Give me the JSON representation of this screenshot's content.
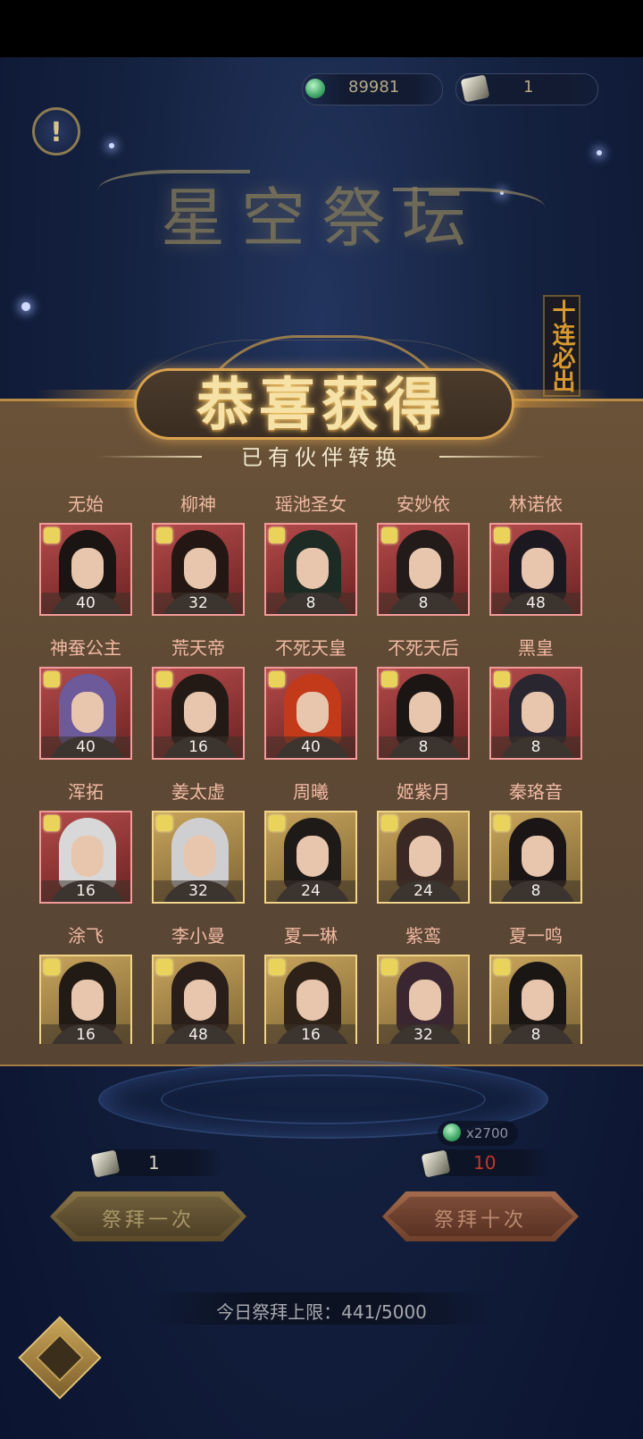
{
  "resources": {
    "jade_value": "89981",
    "scroll_value": "1"
  },
  "altar": {
    "title": "星空祭坛",
    "ten_pull_banner": "十连必出"
  },
  "reward_panel": {
    "title": "恭喜获得",
    "subtitle": "已有伙伴转换",
    "partners": [
      {
        "name": "无始",
        "count": "40",
        "rarity": "red"
      },
      {
        "name": "柳神",
        "count": "32",
        "rarity": "red"
      },
      {
        "name": "瑶池圣女",
        "count": "8",
        "rarity": "red"
      },
      {
        "name": "安妙依",
        "count": "8",
        "rarity": "red"
      },
      {
        "name": "林诺依",
        "count": "48",
        "rarity": "red"
      },
      {
        "name": "神蚕公主",
        "count": "40",
        "rarity": "red"
      },
      {
        "name": "荒天帝",
        "count": "16",
        "rarity": "red"
      },
      {
        "name": "不死天皇",
        "count": "40",
        "rarity": "red"
      },
      {
        "name": "不死天后",
        "count": "8",
        "rarity": "red"
      },
      {
        "name": "黑皇",
        "count": "8",
        "rarity": "red"
      },
      {
        "name": "浑拓",
        "count": "16",
        "rarity": "red"
      },
      {
        "name": "姜太虚",
        "count": "32",
        "rarity": "gold"
      },
      {
        "name": "周曦",
        "count": "24",
        "rarity": "gold"
      },
      {
        "name": "姬紫月",
        "count": "24",
        "rarity": "gold"
      },
      {
        "name": "秦珞音",
        "count": "8",
        "rarity": "gold"
      },
      {
        "name": "涂飞",
        "count": "16",
        "rarity": "gold"
      },
      {
        "name": "李小曼",
        "count": "48",
        "rarity": "gold"
      },
      {
        "name": "夏一琳",
        "count": "16",
        "rarity": "gold"
      },
      {
        "name": "紫鸾",
        "count": "32",
        "rarity": "gold"
      },
      {
        "name": "夏一鸣",
        "count": "8",
        "rarity": "gold"
      }
    ]
  },
  "pray": {
    "single_cost": "1",
    "ten_cost": "10",
    "ten_jade_alt": "x2700",
    "single_label": "祭拜一次",
    "ten_label": "祭拜十次"
  },
  "limit_text": "今日祭拜上限：441/5000",
  "colors": {
    "ten_cost_color": "#c0392b",
    "accent_gold": "#d9a24f",
    "name_color": "#f0b9a3"
  }
}
